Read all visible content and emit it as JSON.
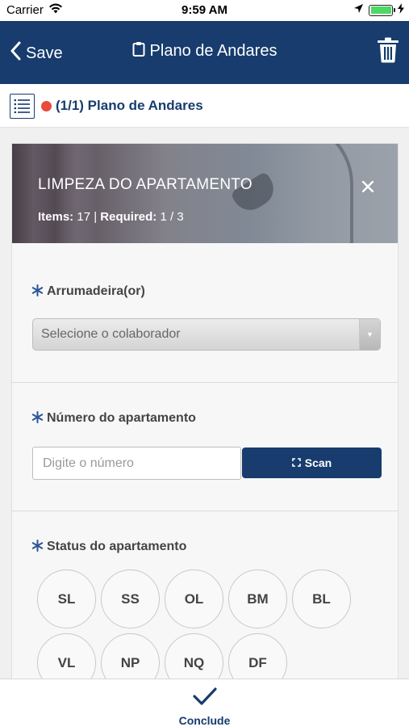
{
  "status_bar": {
    "carrier": "Carrier",
    "time": "9:59 AM",
    "icons": [
      "wifi-icon",
      "location-arrow-icon",
      "battery-icon",
      "charging-bolt-icon"
    ],
    "battery_level": 1.0
  },
  "nav": {
    "back_label": "Save",
    "title": "Plano de Andares",
    "back_icon": "chevron-left-icon",
    "title_icon": "clipboard-icon",
    "action_icon": "trash-icon"
  },
  "sub_header": {
    "title": "(1/1) Plano de Andares",
    "status_color": "#e84c3d",
    "icon": "list-icon"
  },
  "card": {
    "title": "LIMPEZA DO APARTAMENTO",
    "items_label": "Items:",
    "items_value": "17",
    "separator": "|",
    "required_label": "Required:",
    "required_value": "1 / 3",
    "close_icon": "close-icon"
  },
  "fields": {
    "housekeeper": {
      "label": "Arrumadeira(or)",
      "placeholder": "Selecione o colaborador"
    },
    "room_number": {
      "label": "Número do apartamento",
      "placeholder": "Digite o número",
      "scan_label": "Scan"
    },
    "room_status": {
      "label": "Status do apartamento",
      "options": [
        "SL",
        "SS",
        "OL",
        "BM",
        "BL",
        "VL",
        "NP",
        "NQ",
        "DF"
      ]
    }
  },
  "bottom": {
    "conclude_label": "Conclude",
    "icon": "checkmark-icon"
  },
  "colors": {
    "brand": "#173c6d",
    "required": "#2a5596",
    "status_dot": "#e84c3d"
  }
}
